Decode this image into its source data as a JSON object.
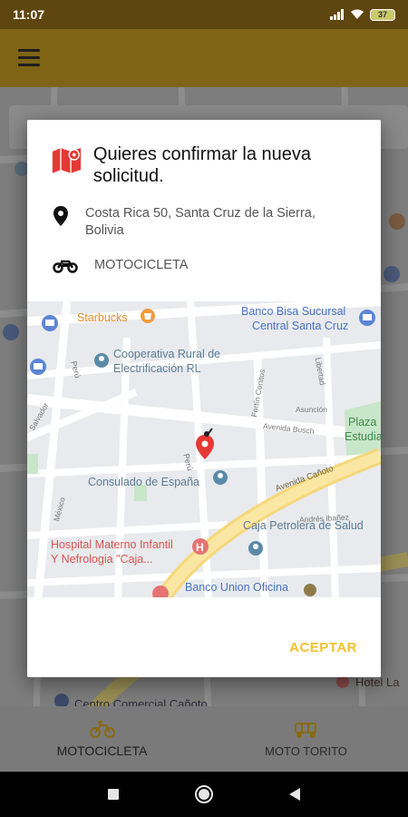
{
  "status_bar": {
    "time": "11:07",
    "battery": "37"
  },
  "dialog": {
    "title": "Quieres confirmar la nueva solicitud.",
    "address": "Costa Rica 50, Santa Cruz de la Sierra, Bolivia",
    "vehicle": "MOTOCICLETA",
    "accept_label": "ACEPTAR",
    "map_labels": {
      "starbucks": "Starbucks",
      "banco_bisa_1": "Banco Bisa Sucursal",
      "banco_bisa_2": "Central Santa Cruz",
      "cooperativa_1": "Cooperativa Rural de",
      "cooperativa_2": "Electrificación RL",
      "consulado": "Consulado de España",
      "avenida_canoto": "Avenida Cañoto",
      "caja_petrolera": "Caja Petrolera de Salud",
      "hospital_1": "Hospital Materno Infantil",
      "hospital_2": "Y Nefrologia \"Caja...",
      "banco_union": "Banco Union Oficina",
      "plaza_1": "Plaza",
      "plaza_2": "Estudia",
      "peru_1": "Perú",
      "peru_2": "Perú",
      "fortin": "Fortín Conitos",
      "libertad": "Libertad",
      "asuncion": "Asunción",
      "avenida_busch": "Avenida Busch",
      "salvador": "Salvador",
      "mexico": "México",
      "andres_ibanez": "Andrés Ibañez"
    }
  },
  "bg_map_labels": {
    "centro_comercial": "Centro Comercial Cañoto",
    "hotel": "Hotel La"
  },
  "bottom_nav": {
    "tab1": "MOTOCICLETA",
    "tab2": "MOTO TORITO"
  },
  "colors": {
    "accent": "#f2c12e",
    "map_marker_red": "#e53935",
    "app_bar": "#7e6414"
  }
}
